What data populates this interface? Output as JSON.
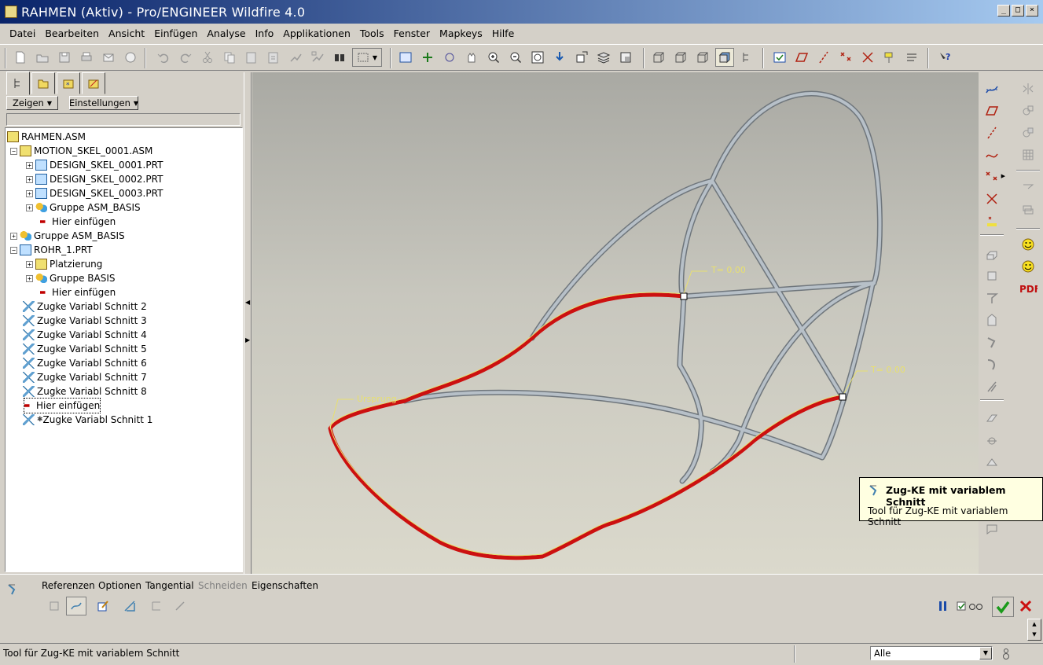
{
  "window": {
    "title": "RAHMEN (Aktiv) - Pro/ENGINEER Wildfire 4.0",
    "controls": [
      "_",
      "□",
      "×"
    ]
  },
  "menu": [
    {
      "label": "Datei"
    },
    {
      "label": "Bearbeiten"
    },
    {
      "label": "Ansicht"
    },
    {
      "label": "Einfügen"
    },
    {
      "label": "Analyse"
    },
    {
      "label": "Info"
    },
    {
      "label": "Applikationen"
    },
    {
      "label": "Tools"
    },
    {
      "label": "Fenster"
    },
    {
      "label": "Mapkeys"
    },
    {
      "label": "Hilfe"
    }
  ],
  "navigator": {
    "show_label": "Zeigen",
    "settings_label": "Einstellungen",
    "tree": [
      {
        "label": "RAHMEN.ASM"
      },
      {
        "label": "MOTION_SKEL_0001.ASM"
      },
      {
        "label": "DESIGN_SKEL_0001.PRT"
      },
      {
        "label": "DESIGN_SKEL_0002.PRT"
      },
      {
        "label": "DESIGN_SKEL_0003.PRT"
      },
      {
        "label": "Gruppe ASM_BASIS"
      },
      {
        "label": "Hier einfügen"
      },
      {
        "label": "Gruppe ASM_BASIS"
      },
      {
        "label": "ROHR_1.PRT"
      },
      {
        "label": "Platzierung"
      },
      {
        "label": "Gruppe BASIS"
      },
      {
        "label": "Hier einfügen"
      },
      {
        "label": "Zugke Variabl Schnitt 2"
      },
      {
        "label": "Zugke Variabl Schnitt 3"
      },
      {
        "label": "Zugke Variabl Schnitt 4"
      },
      {
        "label": "Zugke Variabl Schnitt 5"
      },
      {
        "label": "Zugke Variabl Schnitt 6"
      },
      {
        "label": "Zugke Variabl Schnitt 7"
      },
      {
        "label": "Zugke Variabl Schnitt 8"
      },
      {
        "label": "Hier einfügen"
      },
      {
        "label": "Zugke Variabl Schnitt 1"
      }
    ]
  },
  "viewport": {
    "annotations": [
      "T= 0.00",
      "T= 0.00",
      "Ursprung"
    ],
    "annotation_color": "#e8e070",
    "trajectory_color": "#cc1010",
    "frame_color": "#8e969c"
  },
  "tooltip": {
    "title": "Zug-KE mit variablem Schnitt",
    "body": "Tool für Zug-KE mit variablem Schnitt"
  },
  "dashboard": {
    "tabs": [
      {
        "label": "Referenzen"
      },
      {
        "label": "Optionen"
      },
      {
        "label": "Tangential"
      },
      {
        "label": "Schneiden"
      },
      {
        "label": "Eigenschaften"
      }
    ]
  },
  "status": {
    "message": "Tool für Zug-KE mit variablem Schnitt",
    "filter_value": "Alle"
  },
  "colors": {
    "accept": "#1a9a1a",
    "cancel": "#cc1010",
    "pause": "#1a4aa8"
  }
}
